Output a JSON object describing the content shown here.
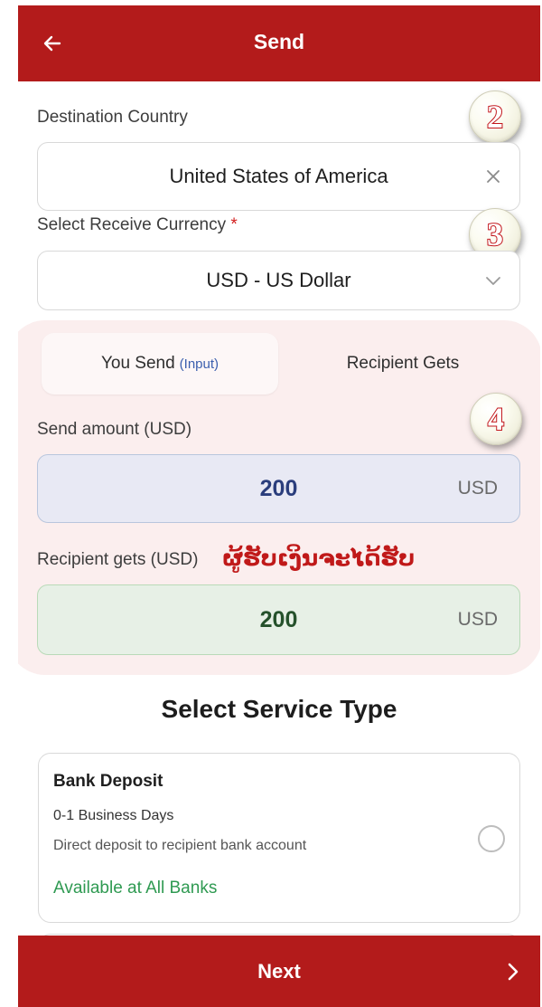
{
  "header": {
    "title": "Send"
  },
  "destination": {
    "label": "Destination Country",
    "value": "United States of America"
  },
  "currency": {
    "label": "Select Receive Currency",
    "required_mark": "*",
    "value": "USD - US Dollar"
  },
  "steps": [
    "2",
    "3",
    "4"
  ],
  "tabs": [
    {
      "label": "You Send",
      "hint": "(Input)"
    },
    {
      "label": "Recipient Gets"
    }
  ],
  "send_amount": {
    "label": "Send amount (USD)",
    "value": "200",
    "currency": "USD"
  },
  "recipient_amount": {
    "label": "Recipient gets (USD)",
    "value": "200",
    "currency": "USD",
    "note": "ຜູ້ຮັບເງິນຈະໄດ້ຮັບ"
  },
  "service": {
    "title": "Select Service Type",
    "options": [
      {
        "name": "Bank Deposit",
        "days": "0-1 Business Days",
        "description": "Direct deposit to recipient bank account",
        "availability": "Available at All Banks"
      }
    ]
  },
  "footer": {
    "next_label": "Next"
  },
  "colors": {
    "brand": "#b31b1b",
    "send_field_bg": "#e8e9f4",
    "recipient_field_bg": "#e7f0e6",
    "available": "#2f9a52"
  }
}
